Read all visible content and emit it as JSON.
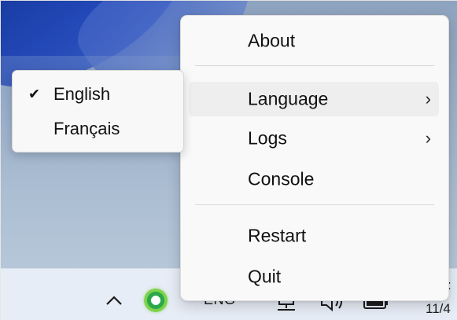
{
  "context_menu": {
    "items": [
      {
        "label": "About"
      },
      {
        "label": "Language",
        "arrow": "›"
      },
      {
        "label": "Logs",
        "arrow": "›"
      },
      {
        "label": "Console"
      },
      {
        "label": "Restart"
      },
      {
        "label": "Quit"
      }
    ],
    "highlighted_item": "Language"
  },
  "language_submenu": {
    "items": [
      {
        "label": "English",
        "check": "✔",
        "checked": true
      },
      {
        "label": "Français",
        "checked": false
      }
    ]
  },
  "taskbar": {
    "tray": {
      "overflow_icon": "chevron-up-icon",
      "app_icon": "green-ring-icon",
      "language_indicator": "ENG",
      "network_icon": "monitor-network-icon",
      "volume_icon": "speaker-icon",
      "battery_icon": "battery-icon"
    },
    "clock": {
      "time_fragment": ":",
      "date_fragment": "11/4"
    }
  },
  "colors": {
    "menu_background": "#f9f9f9",
    "menu_hover": "#eeeeee",
    "wallpaper_blue": "#2247b6",
    "taskbar": "#e7edf6",
    "tray_app_green": "#2aa84a"
  }
}
